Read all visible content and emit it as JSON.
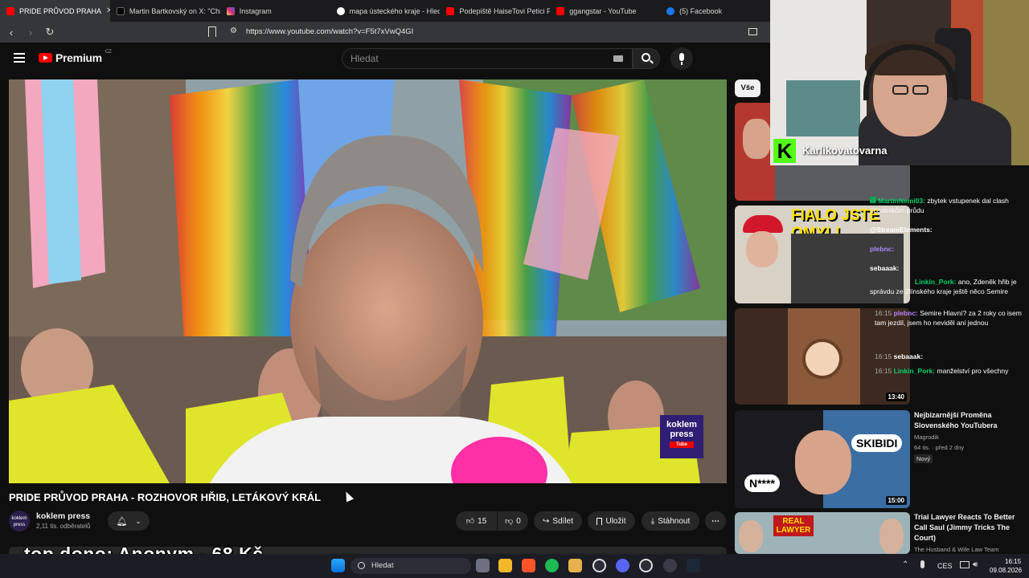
{
  "browser": {
    "tabs": [
      {
        "label": "PRIDE PRŮVOD PRAHA",
        "color": "#ff0000",
        "active": true
      },
      {
        "label": "Martin Bartkovský on X: \"Chip",
        "color": "#000000"
      },
      {
        "label": "Instagram",
        "color": "#d62976"
      },
      {
        "label": "mapa ústeckého kraje - Hledat",
        "color": "#4285f4"
      },
      {
        "label": "Podepiště HaiseTovi Petici Pro",
        "color": "#ff0000"
      },
      {
        "label": "ggangstar - YouTube",
        "color": "#ff0000"
      },
      {
        "label": "(5) Facebook",
        "color": "#1877f2"
      }
    ],
    "url": "https://www.youtube.com/watch?v=F5t7xVwQ4GI"
  },
  "youtube": {
    "logo_text": "Premium",
    "region": "CZ",
    "search_placeholder": "Hledat"
  },
  "video": {
    "title": "PRIDE PRŮVOD PRAHA - ROZHOVOR HŘIB, LETÁKOVÝ KRÁL",
    "watermark_line1": "koklem",
    "watermark_line2": "press",
    "watermark_line3": "Tube",
    "channel": {
      "name": "koklem press",
      "subscribers": "2,11 tis. odběratelů",
      "avatar_text": "koklem press"
    },
    "actions": {
      "likes": "15",
      "dislikes": "0",
      "share": "Sdílet",
      "save": "Uložit",
      "download": "Stáhnout"
    }
  },
  "sidebar": {
    "chip": "Vše",
    "items": [
      {
        "thumb_text": "FIALO JSTE OMYL!"
      },
      {
        "duration": "13:40"
      },
      {
        "title": "Nejbizarnější Proměna Slovenského YouTubera",
        "channel": "Magrodik",
        "meta": "64 tis. · před 2 dny",
        "badge": "Nový",
        "thumb_text": "SKIBIDI",
        "thumb_text2": "N****",
        "duration": "15:00"
      },
      {
        "title": "Trial Lawyer Reacts To Better Call Saul (Jimmy Tricks The Court)",
        "channel": "The Husband & Wife Law Team",
        "thumb_text": "REAL LAWYER"
      }
    ]
  },
  "stream": {
    "streamer": "Karlikovatovarna",
    "logo_letter": "K",
    "chat": [
      {
        "time": "",
        "user": "MartinNemi03:",
        "text": "zbytek vstupenek dal clash účastníkům průdu",
        "user_color": "#00d26a"
      },
      {
        "time": "",
        "user": "@StreamElements:",
        "text": "",
        "user_color": "#ffffff"
      },
      {
        "time": "",
        "user": "plebnc:",
        "text": "",
        "user_color": "#b284ff"
      },
      {
        "time": "",
        "user": "sebaaak:",
        "text": "",
        "user_color": "#ffffff"
      },
      {
        "time": "",
        "user": "Linkin_Pork:",
        "text": "ano, Zdeněk hřib je správdu ze Zlínského kraje ještě něco Semire",
        "user_color": "#00d26a"
      },
      {
        "time": "16:15",
        "user": "plebnc:",
        "text": "Semire Hlavní? za 2 roky co isem tam jezdil, jsem ho neviděl ani jednou",
        "user_color": "#b284ff"
      },
      {
        "time": "16:15",
        "user": "sebaaak:",
        "text": "",
        "user_color": "#ffffff"
      },
      {
        "time": "16:15",
        "user": "Linkin_Pork:",
        "text": "manželství pro všechny",
        "user_color": "#00d26a"
      }
    ]
  },
  "donation": {
    "text": "top dono:  Anonym  -  68 Kč"
  },
  "taskbar": {
    "search": "Hledat",
    "lang": "CES",
    "time": "16:15",
    "date": "09.08.2026"
  }
}
